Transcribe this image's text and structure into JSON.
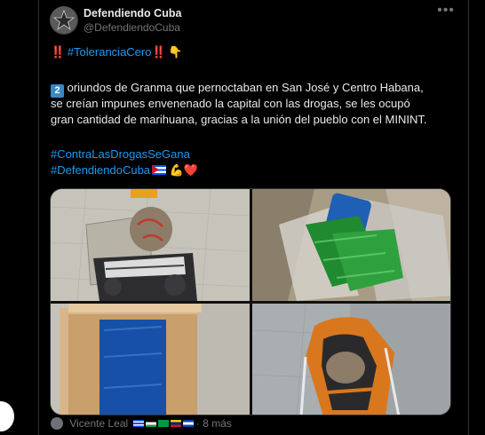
{
  "tweet": {
    "author_name": "Defendiendo Cuba",
    "author_handle": "@DefendiendoCuba",
    "more_icon": "•••",
    "line1_hashtag": "#ToleranciaCero",
    "line1_prefix_emoji": "‼️",
    "line1_suffix_emoji": "‼️",
    "line1_hand": "👇",
    "number_badge": "2",
    "line2": "oriundos de Granma que pernoctaban en San José y Centro Habana,",
    "line3": "se creían impunes envenenado la capital con las drogas, se les ocupó",
    "line4": "gran cantidad de marihuana, gracias a la unión del pueblo con el MININT.",
    "hashtag1": "#ContraLasDrogasSeGana",
    "hashtag2": "#DefendiendoCuba",
    "muscle_emoji": "💪",
    "heart_emoji": "❤️",
    "footer_name": "Vicente Leal",
    "footer_time": "8 más"
  },
  "colors": {
    "background": "#000000",
    "text": "#e7e9ea",
    "muted": "#71767b",
    "link": "#1d9bf0",
    "border": "#2f3336"
  },
  "media": {
    "images": [
      {
        "alt_icon": "package-on-floor-photo"
      },
      {
        "alt_icon": "green-packages-in-box-photo"
      },
      {
        "alt_icon": "blue-package-in-box-photo"
      },
      {
        "alt_icon": "open-backpack-photo"
      }
    ]
  }
}
